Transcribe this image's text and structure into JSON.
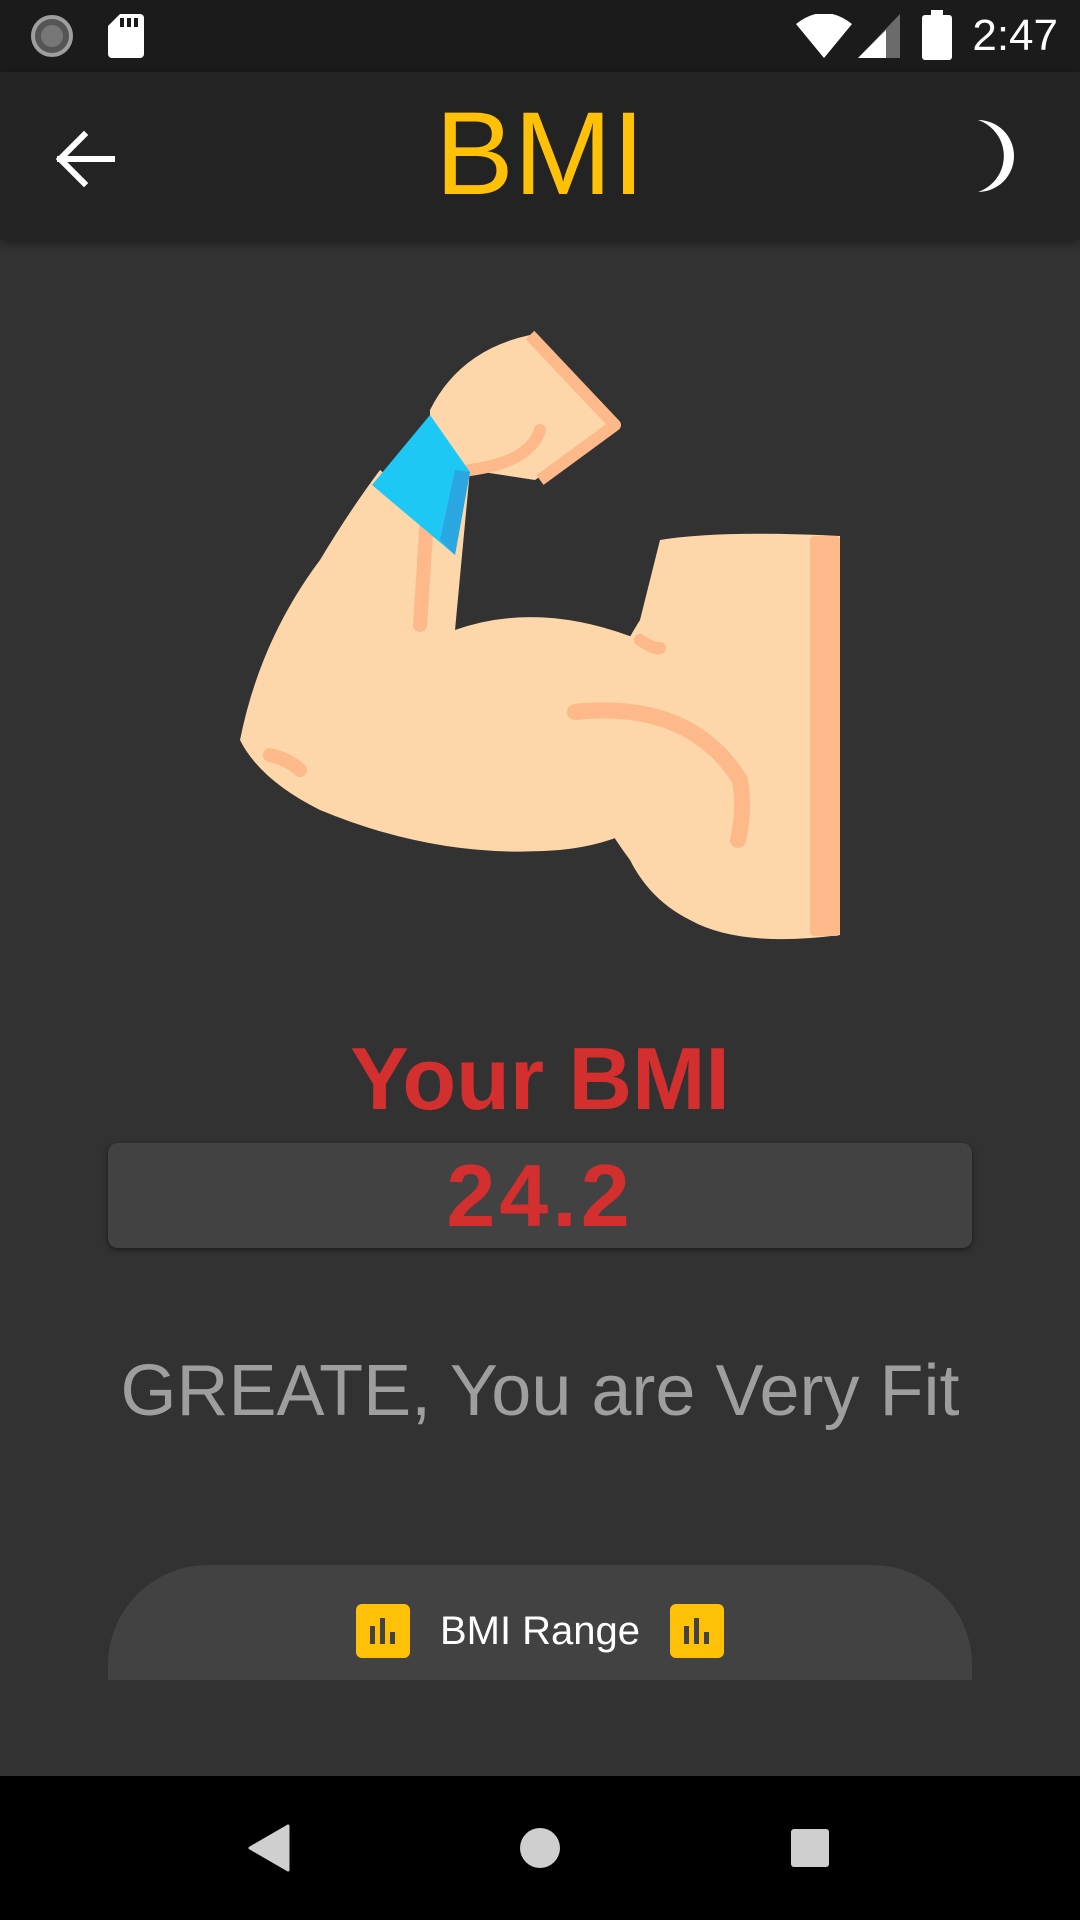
{
  "status_bar": {
    "time": "2:47",
    "icons": [
      "sync-icon",
      "sd-card-icon",
      "wifi-icon",
      "signal-icon",
      "battery-icon"
    ]
  },
  "app_bar": {
    "title": "BMI",
    "back_icon": "arrow-left-icon",
    "theme_icon": "moon-icon"
  },
  "illustration": {
    "icon": "flexed-arm-icon"
  },
  "result": {
    "label": "Your BMI",
    "value": "24.2",
    "message": "GREATE, You are Very Fit"
  },
  "range_button": {
    "label": "BMI Range",
    "icon": "bar-chart-icon"
  },
  "nav_bar": {
    "icons": [
      "back-triangle-icon",
      "home-circle-icon",
      "recents-square-icon"
    ]
  },
  "colors": {
    "accent": "#ffc107",
    "result_red": "#d32f2f",
    "background": "#323232",
    "app_bar": "#232323"
  }
}
